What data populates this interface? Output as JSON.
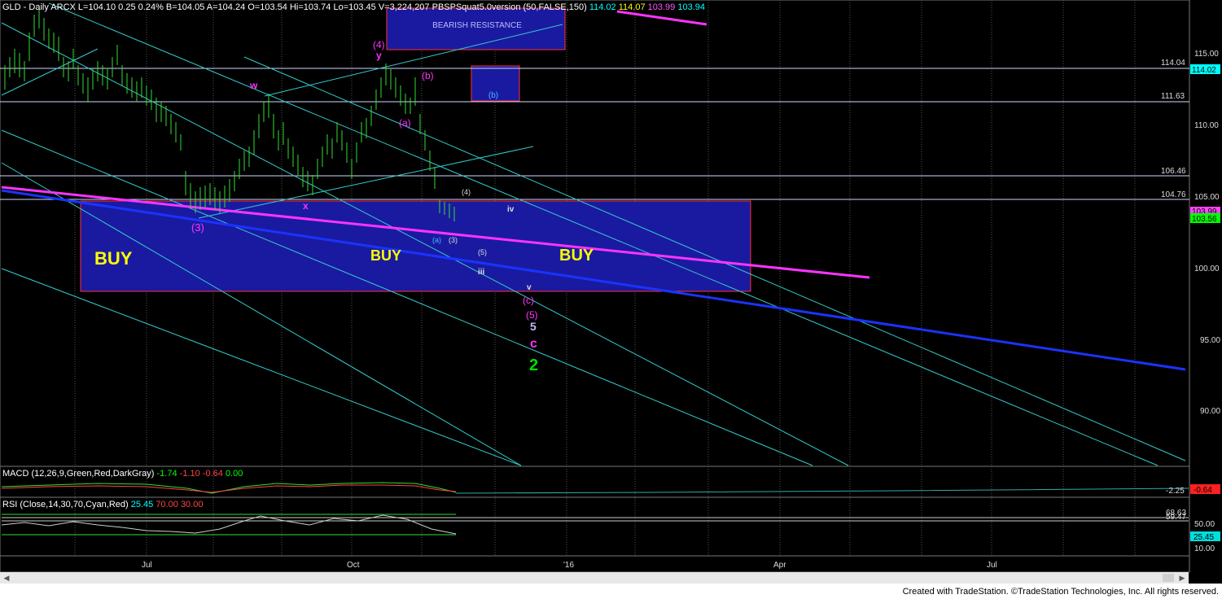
{
  "header": {
    "symbol": "GLD - Daily  ARCX",
    "last": "L=104.10",
    "change": "0.25",
    "pct": "0.24%",
    "bid": "B=104.05",
    "ask": "A=104.24",
    "open": "O=103.54",
    "hi": "Hi=103.74",
    "lo": "Lo=103.45",
    "volume": "V=3,224,207",
    "indicator": "PBSPSquat5.0version (50,FALSE,150)",
    "ind_values": [
      "114.02",
      "114.07",
      "103.99",
      "103.94"
    ],
    "colors": {
      "white": "#ffffff",
      "green": "#00ff00",
      "cyan": "#00ffff",
      "yellow": "#ffff00",
      "magenta": "#ff55ff"
    }
  },
  "macd_header": {
    "label": "MACD (12,26,9,Green,Red,DarkGray)",
    "values": [
      "-1.74",
      "-1.10",
      "-0.64",
      "0.00"
    ]
  },
  "rsi_header": {
    "label": "RSI (Close,14,30,70,Cyan,Red)",
    "values": [
      "25.45",
      "70.00",
      "30.00"
    ]
  },
  "chart_data": {
    "type": "candlestick",
    "y_ticks": [
      "115.00",
      "110.00",
      "105.00",
      "100.00",
      "95.00",
      "90.00"
    ],
    "x_ticks": [
      "Jul",
      "Oct",
      "'16",
      "Apr",
      "Jul"
    ],
    "price_lines": [
      "114.04",
      "111.63",
      "106.46",
      "104.76"
    ],
    "price_tags": [
      {
        "value": "114.02",
        "color": "#00ffff"
      },
      {
        "value": "103.99",
        "color": "#ff44ff"
      },
      {
        "value": "103.56",
        "color": "#00ff00"
      }
    ],
    "macd_tags": {
      "level": "-2.25",
      "value": "-0.64"
    },
    "rsi_axis": [
      "68.63",
      "59.47",
      "50.00",
      "10.00"
    ],
    "rsi_value": "25.45",
    "zones": {
      "bearish_resistance": "BEARISH RESISTANCE",
      "b_box": "(b)",
      "buy": [
        "BUY",
        "BUY",
        "BUY"
      ]
    },
    "wave_labels": {
      "w": "w",
      "x": "x",
      "y": "y",
      "four": "(4)",
      "three": "(3)",
      "a": "(a)",
      "b": "(b)",
      "c": "(c)",
      "small_four": "(4)",
      "small_a": "(a)",
      "small_three": "(3)",
      "small_five": "(5)",
      "iii": "iii",
      "iv": "iv",
      "v": "v",
      "five_paren": "(5)",
      "five": "5",
      "c_plain": "c",
      "two": "2"
    }
  },
  "footer": {
    "credit": "Created with TradeStation. ©TradeStation Technologies, Inc. All rights reserved."
  }
}
